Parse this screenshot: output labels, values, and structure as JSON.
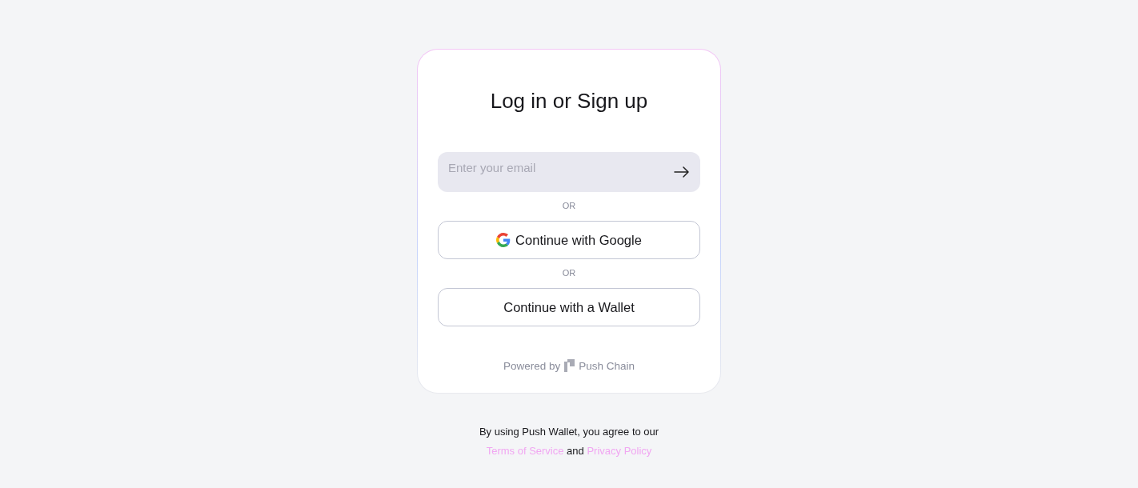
{
  "card": {
    "title": "Log in or Sign up",
    "email_field": {
      "placeholder": "Enter your email"
    },
    "options": [
      {
        "separator": "OR",
        "label": "Continue with Google",
        "kind": "google"
      },
      {
        "separator": "OR",
        "label": "Continue with a Wallet",
        "kind": "plain"
      }
    ],
    "powered_by": {
      "prefix": "Powered by",
      "brand": "Push Chain"
    }
  },
  "footer": [
    {
      "kind": "text",
      "text": "By using Push Wallet, you agree to our "
    },
    {
      "kind": "link",
      "text": "Terms of Service"
    },
    {
      "kind": "text",
      "text": " and "
    },
    {
      "kind": "link",
      "text": "Privacy Policy"
    }
  ]
}
